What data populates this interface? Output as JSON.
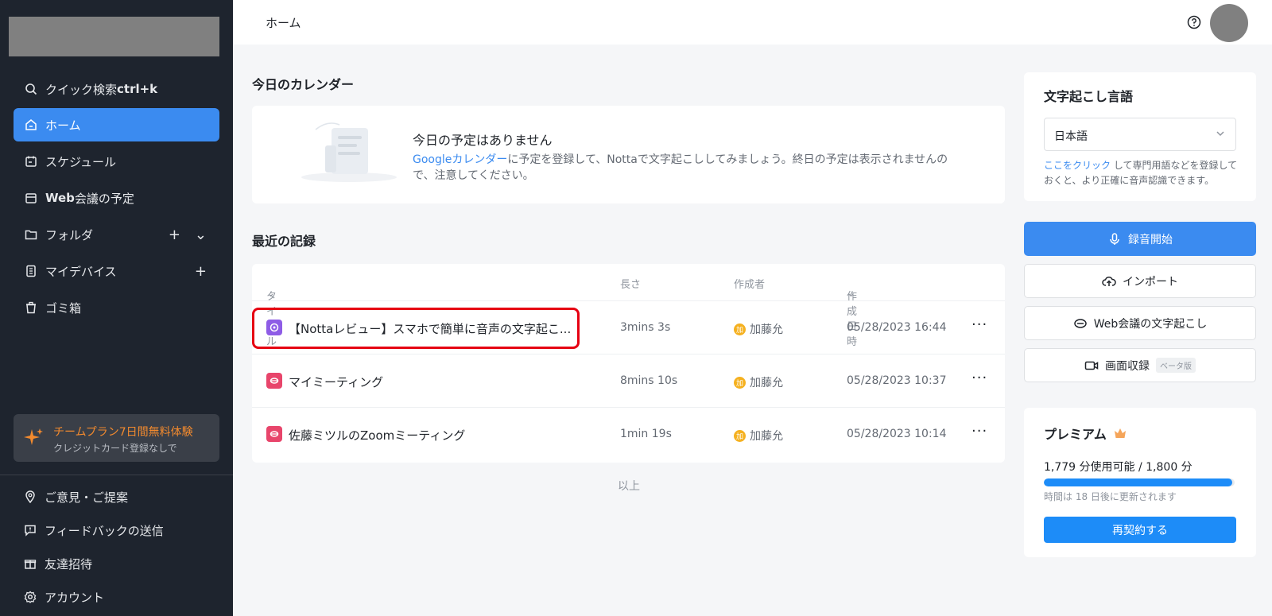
{
  "sidebar": {
    "search_label": "クイック検索 ",
    "search_shortcut": "ctrl+k",
    "items": [
      {
        "label": "ホーム"
      },
      {
        "label": "スケジュール"
      },
      {
        "label": "会議の予定",
        "prefix": "Web"
      },
      {
        "label": "フォルダ"
      },
      {
        "label": "マイデバイス"
      },
      {
        "label": "ゴミ箱"
      }
    ],
    "promo": {
      "title": "チームプラン7日間無料体験",
      "subtitle": "クレジットカード登録なしで"
    },
    "footer": [
      {
        "label": "ご意見・ご提案"
      },
      {
        "label": "フィードバックの送信"
      },
      {
        "label": "友達招待"
      },
      {
        "label": "アカウント"
      }
    ]
  },
  "header": {
    "breadcrumb": "ホーム"
  },
  "calendar": {
    "section_title": "今日のカレンダー",
    "empty_title": "今日の予定はありません",
    "link_text": "Googleカレンダー",
    "desc_text": "に予定を登録して、Nottaで文字起こししてみましょう。終日の予定は表示されませんので、注意してください。"
  },
  "records": {
    "section_title": "最近の記録",
    "columns": {
      "title": "タイトル",
      "length": "長さ",
      "author": "作成者",
      "created": "作成日時"
    },
    "rows": [
      {
        "title": "【Nottaレビュー】スマホで簡単に音声の文字起こ...",
        "length": "3mins 3s",
        "author": "加藤允",
        "author_initial": "加",
        "date": "05/28/2023 16:44",
        "more": "···",
        "badge_color": "#8e5ce6"
      },
      {
        "title": "マイミーティング",
        "length": "8mins 10s",
        "author": "加藤允",
        "author_initial": "加",
        "date": "05/28/2023 10:37",
        "more": "···",
        "badge_color": "#e8456b"
      },
      {
        "title": "佐藤ミツルのZoomミーティング",
        "length": "1min 19s",
        "author": "加藤允",
        "author_initial": "加",
        "date": "05/28/2023 10:14",
        "more": "···",
        "badge_color": "#e8456b"
      }
    ],
    "end_label": "以上"
  },
  "language": {
    "title": "文字起こし言語",
    "selected": "日本語",
    "note_link": "ここをクリック",
    "note_text": " して専門用語などを登録しておくと、より正確に音声認識できます。"
  },
  "actions": {
    "record": "録音開始",
    "import": "インポート",
    "web_meeting": "Web会議の文字起こし",
    "screen_record": "画面収録",
    "beta": "ベータ版"
  },
  "premium": {
    "title": "プレミアム",
    "usage": "1,779 分使用可能 / 1,800 分",
    "usage_fraction": 0.988,
    "renew": "時間は 18 日後に更新されます",
    "cta": "再契約する"
  },
  "colors": {
    "accent": "#3b8bf0",
    "sidebar_bg": "#1e242e",
    "highlight": "#e60012",
    "promo_text": "#f28a2e"
  }
}
